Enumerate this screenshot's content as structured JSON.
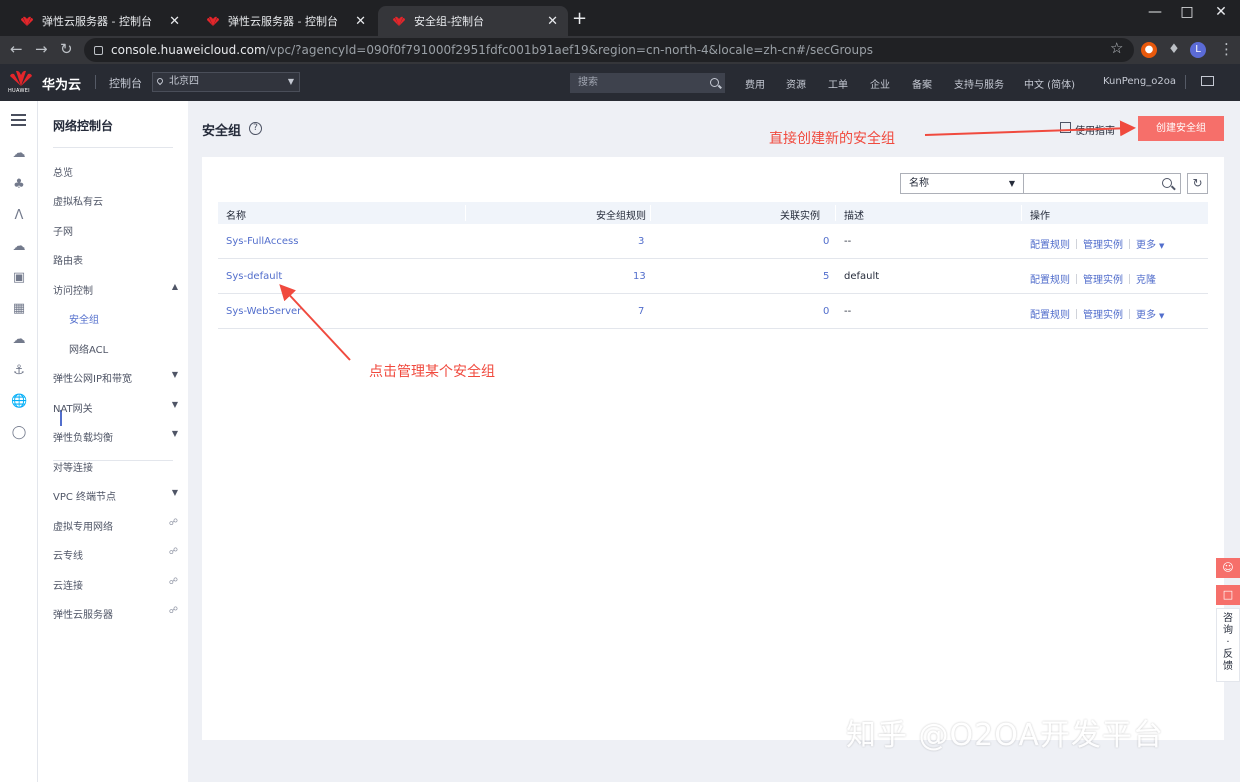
{
  "browser": {
    "tabs": [
      {
        "title": "弹性云服务器 - 控制台",
        "active": false
      },
      {
        "title": "弹性云服务器 - 控制台",
        "active": false
      },
      {
        "title": "安全组-控制台",
        "active": true
      }
    ],
    "url_host": "console.huaweicloud.com",
    "url_path": "/vpc/?agencyId=090f0f791000f2951fdfc001b91aef19&region=cn-north-4&locale=zh-cn#/secGroups",
    "profile_initial": "L",
    "new_tab": "+",
    "close_glyph": "✕"
  },
  "header": {
    "logo_text": "HUAWEI",
    "brand": "华为云",
    "console": "控制台",
    "region": "北京四",
    "search_placeholder": "搜索",
    "nav": [
      "费用",
      "资源",
      "工单",
      "企业",
      "备案",
      "支持与服务",
      "中文 (简体)",
      "KunPeng_o2oa"
    ],
    "brand_color": "#e3262b"
  },
  "menu": {
    "title": "网络控制台",
    "items": [
      {
        "label": "总览"
      },
      {
        "label": "虚拟私有云"
      },
      {
        "label": "子网"
      },
      {
        "label": "路由表"
      },
      {
        "label": "访问控制",
        "expanded": true
      },
      {
        "label": "弹性公网IP和带宽"
      },
      {
        "label": "NAT网关"
      },
      {
        "label": "弹性负载均衡"
      },
      {
        "label": "对等连接"
      },
      {
        "label": "VPC 终端节点"
      },
      {
        "label": "虚拟专用网络"
      },
      {
        "label": "云专线"
      },
      {
        "label": "云连接"
      },
      {
        "label": "弹性云服务器"
      }
    ],
    "sub_items": [
      {
        "label": "安全组",
        "active": true
      },
      {
        "label": "网络ACL"
      }
    ]
  },
  "main": {
    "title": "安全组",
    "guide": "使用指南",
    "create_button": "创建安全组",
    "filter_select": "名称",
    "columns": [
      "名称",
      "安全组规则",
      "关联实例",
      "描述",
      "操作"
    ],
    "rows": [
      {
        "name": "Sys-FullAccess",
        "rules": "3",
        "instances": "0",
        "desc": "--",
        "ops": [
          "配置规则",
          "管理实例",
          "更多"
        ]
      },
      {
        "name": "Sys-default",
        "rules": "13",
        "instances": "5",
        "desc": "default",
        "ops": [
          "配置规则",
          "管理实例",
          "克隆"
        ]
      },
      {
        "name": "Sys-WebServer",
        "rules": "7",
        "instances": "0",
        "desc": "--",
        "ops": [
          "配置规则",
          "管理实例",
          "更多"
        ]
      }
    ]
  },
  "annotations": {
    "create_tip": "直接创建新的安全组",
    "manage_tip": "点击管理某个安全组",
    "color": "#f04a3e"
  },
  "feedback": {
    "label_chars": [
      "咨",
      "询",
      "·",
      "反",
      "馈"
    ]
  },
  "watermark": "知乎 @O2OA开发平台"
}
